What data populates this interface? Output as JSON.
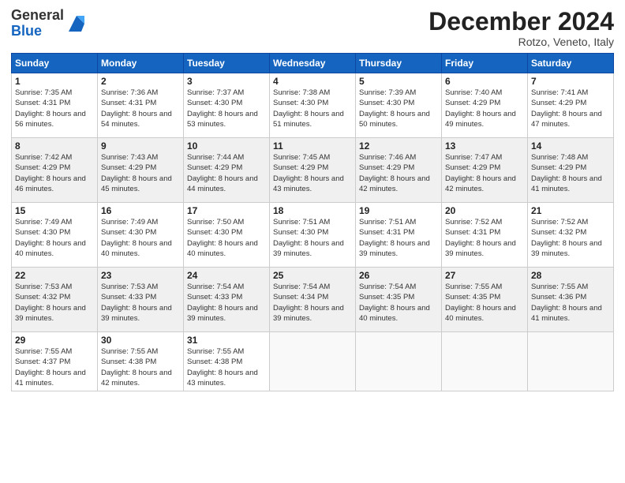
{
  "logo": {
    "general": "General",
    "blue": "Blue"
  },
  "header": {
    "month": "December 2024",
    "location": "Rotzo, Veneto, Italy"
  },
  "weekdays": [
    "Sunday",
    "Monday",
    "Tuesday",
    "Wednesday",
    "Thursday",
    "Friday",
    "Saturday"
  ],
  "weeks": [
    [
      {
        "day": 1,
        "sunrise": "7:35 AM",
        "sunset": "4:31 PM",
        "daylight": "8 hours and 56 minutes."
      },
      {
        "day": 2,
        "sunrise": "7:36 AM",
        "sunset": "4:31 PM",
        "daylight": "8 hours and 54 minutes."
      },
      {
        "day": 3,
        "sunrise": "7:37 AM",
        "sunset": "4:30 PM",
        "daylight": "8 hours and 53 minutes."
      },
      {
        "day": 4,
        "sunrise": "7:38 AM",
        "sunset": "4:30 PM",
        "daylight": "8 hours and 51 minutes."
      },
      {
        "day": 5,
        "sunrise": "7:39 AM",
        "sunset": "4:30 PM",
        "daylight": "8 hours and 50 minutes."
      },
      {
        "day": 6,
        "sunrise": "7:40 AM",
        "sunset": "4:29 PM",
        "daylight": "8 hours and 49 minutes."
      },
      {
        "day": 7,
        "sunrise": "7:41 AM",
        "sunset": "4:29 PM",
        "daylight": "8 hours and 47 minutes."
      }
    ],
    [
      {
        "day": 8,
        "sunrise": "7:42 AM",
        "sunset": "4:29 PM",
        "daylight": "8 hours and 46 minutes."
      },
      {
        "day": 9,
        "sunrise": "7:43 AM",
        "sunset": "4:29 PM",
        "daylight": "8 hours and 45 minutes."
      },
      {
        "day": 10,
        "sunrise": "7:44 AM",
        "sunset": "4:29 PM",
        "daylight": "8 hours and 44 minutes."
      },
      {
        "day": 11,
        "sunrise": "7:45 AM",
        "sunset": "4:29 PM",
        "daylight": "8 hours and 43 minutes."
      },
      {
        "day": 12,
        "sunrise": "7:46 AM",
        "sunset": "4:29 PM",
        "daylight": "8 hours and 42 minutes."
      },
      {
        "day": 13,
        "sunrise": "7:47 AM",
        "sunset": "4:29 PM",
        "daylight": "8 hours and 42 minutes."
      },
      {
        "day": 14,
        "sunrise": "7:48 AM",
        "sunset": "4:29 PM",
        "daylight": "8 hours and 41 minutes."
      }
    ],
    [
      {
        "day": 15,
        "sunrise": "7:49 AM",
        "sunset": "4:30 PM",
        "daylight": "8 hours and 40 minutes."
      },
      {
        "day": 16,
        "sunrise": "7:49 AM",
        "sunset": "4:30 PM",
        "daylight": "8 hours and 40 minutes."
      },
      {
        "day": 17,
        "sunrise": "7:50 AM",
        "sunset": "4:30 PM",
        "daylight": "8 hours and 40 minutes."
      },
      {
        "day": 18,
        "sunrise": "7:51 AM",
        "sunset": "4:30 PM",
        "daylight": "8 hours and 39 minutes."
      },
      {
        "day": 19,
        "sunrise": "7:51 AM",
        "sunset": "4:31 PM",
        "daylight": "8 hours and 39 minutes."
      },
      {
        "day": 20,
        "sunrise": "7:52 AM",
        "sunset": "4:31 PM",
        "daylight": "8 hours and 39 minutes."
      },
      {
        "day": 21,
        "sunrise": "7:52 AM",
        "sunset": "4:32 PM",
        "daylight": "8 hours and 39 minutes."
      }
    ],
    [
      {
        "day": 22,
        "sunrise": "7:53 AM",
        "sunset": "4:32 PM",
        "daylight": "8 hours and 39 minutes."
      },
      {
        "day": 23,
        "sunrise": "7:53 AM",
        "sunset": "4:33 PM",
        "daylight": "8 hours and 39 minutes."
      },
      {
        "day": 24,
        "sunrise": "7:54 AM",
        "sunset": "4:33 PM",
        "daylight": "8 hours and 39 minutes."
      },
      {
        "day": 25,
        "sunrise": "7:54 AM",
        "sunset": "4:34 PM",
        "daylight": "8 hours and 39 minutes."
      },
      {
        "day": 26,
        "sunrise": "7:54 AM",
        "sunset": "4:35 PM",
        "daylight": "8 hours and 40 minutes."
      },
      {
        "day": 27,
        "sunrise": "7:55 AM",
        "sunset": "4:35 PM",
        "daylight": "8 hours and 40 minutes."
      },
      {
        "day": 28,
        "sunrise": "7:55 AM",
        "sunset": "4:36 PM",
        "daylight": "8 hours and 41 minutes."
      }
    ],
    [
      {
        "day": 29,
        "sunrise": "7:55 AM",
        "sunset": "4:37 PM",
        "daylight": "8 hours and 41 minutes."
      },
      {
        "day": 30,
        "sunrise": "7:55 AM",
        "sunset": "4:38 PM",
        "daylight": "8 hours and 42 minutes."
      },
      {
        "day": 31,
        "sunrise": "7:55 AM",
        "sunset": "4:38 PM",
        "daylight": "8 hours and 43 minutes."
      },
      null,
      null,
      null,
      null
    ]
  ],
  "labels": {
    "sunrise": "Sunrise:",
    "sunset": "Sunset:",
    "daylight": "Daylight:"
  }
}
